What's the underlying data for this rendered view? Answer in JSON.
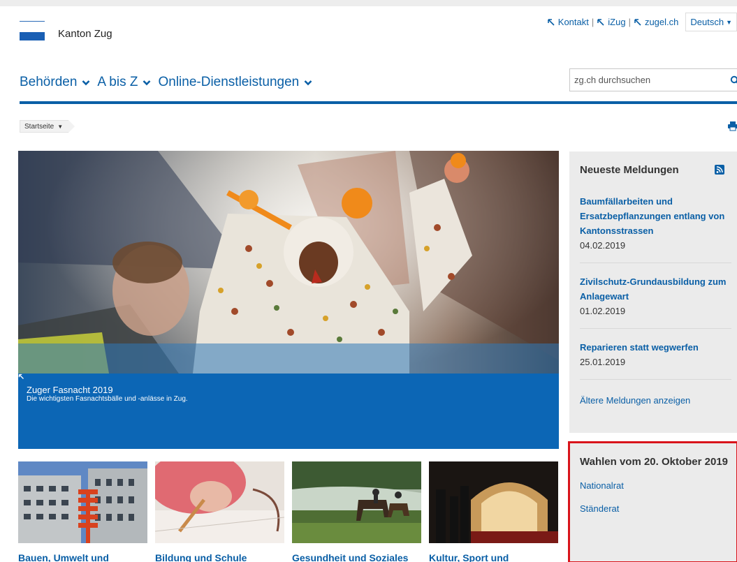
{
  "logo": {
    "text": "Kanton Zug"
  },
  "service_nav": {
    "links": [
      {
        "label": "Kontakt"
      },
      {
        "label": "iZug"
      },
      {
        "label": "zugel.ch"
      }
    ],
    "language": "Deutsch"
  },
  "main_nav": {
    "items": [
      {
        "label": "Behörden"
      },
      {
        "label": "A bis Z"
      },
      {
        "label": "Online-Dienstleistungen"
      }
    ]
  },
  "search": {
    "placeholder": "zg.ch durchsuchen"
  },
  "breadcrumb": {
    "home": "Startseite"
  },
  "hero": {
    "title": "Zuger Fasnacht 2019",
    "subtitle": "Die wichtigsten Fasnachtsbälle und -anlässe in Zug."
  },
  "news": {
    "title": "Neueste Meldungen",
    "items": [
      {
        "headline": "Baumfällarbeiten und Ersatzbepflanzungen entlang von Kantonsstrassen",
        "date": "04.02.2019"
      },
      {
        "headline": "Zivilschutz-Grundausbildung zum Anlagewart",
        "date": "01.02.2019"
      },
      {
        "headline": "Reparieren statt wegwerfen",
        "date": "25.01.2019"
      }
    ],
    "more_label": "Ältere Meldungen anzeigen"
  },
  "election": {
    "title": "Wahlen vom 20. Oktober 2019",
    "links": [
      {
        "label": "Nationalrat"
      },
      {
        "label": "Ständerat"
      }
    ]
  },
  "tiles": [
    {
      "label": "Bauen, Umwelt und"
    },
    {
      "label": "Bildung und Schule"
    },
    {
      "label": "Gesundheit und Soziales"
    },
    {
      "label": "Kultur, Sport und"
    }
  ],
  "colors": {
    "brand_blue": "#0a5fa6",
    "caption_blue": "#0c66b5",
    "highlight_red": "#d9141b",
    "sidebar_grey": "#ebebeb"
  }
}
